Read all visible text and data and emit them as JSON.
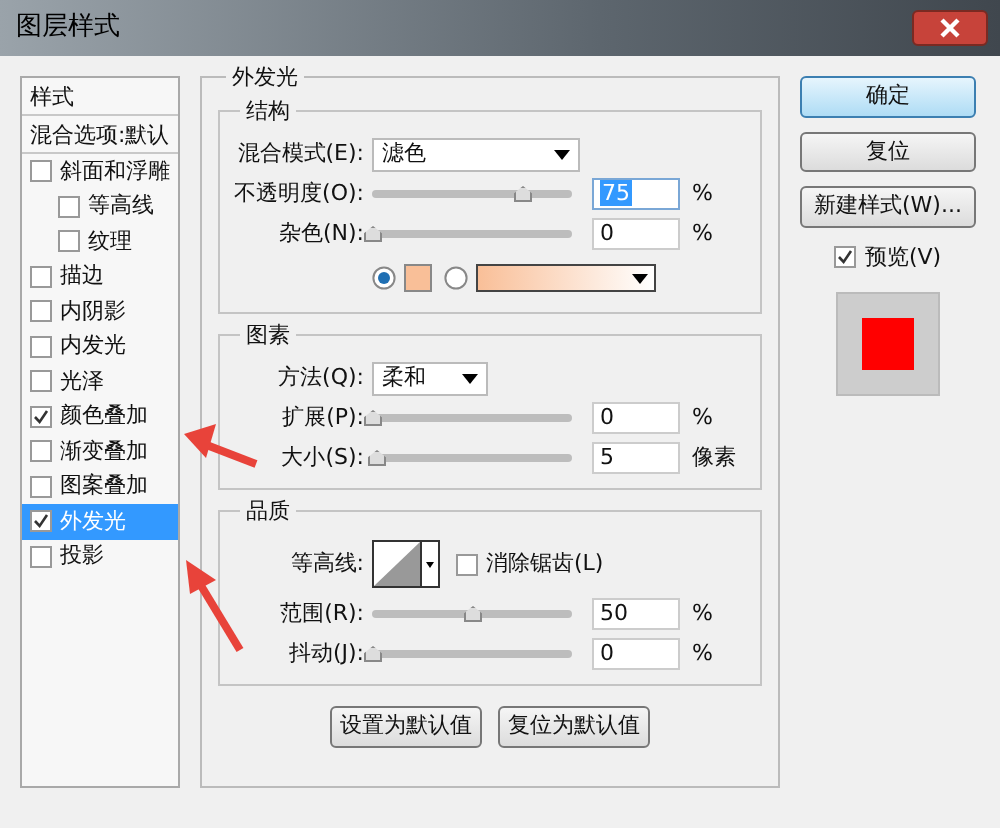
{
  "window": {
    "title": "图层样式"
  },
  "styles_list": {
    "header": "样式",
    "blend_options": "混合选项:默认",
    "items": [
      {
        "label": "斜面和浮雕",
        "checked": false,
        "selected": false,
        "children": [
          {
            "label": "等高线",
            "checked": false,
            "selected": false
          },
          {
            "label": "纹理",
            "checked": false,
            "selected": false
          }
        ]
      },
      {
        "label": "描边",
        "checked": false,
        "selected": false
      },
      {
        "label": "内阴影",
        "checked": false,
        "selected": false
      },
      {
        "label": "内发光",
        "checked": false,
        "selected": false
      },
      {
        "label": "光泽",
        "checked": false,
        "selected": false
      },
      {
        "label": "颜色叠加",
        "checked": true,
        "selected": false
      },
      {
        "label": "渐变叠加",
        "checked": false,
        "selected": false
      },
      {
        "label": "图案叠加",
        "checked": false,
        "selected": false
      },
      {
        "label": "外发光",
        "checked": true,
        "selected": true
      },
      {
        "label": "投影",
        "checked": false,
        "selected": false
      }
    ]
  },
  "outer_glow": {
    "title": "外发光",
    "groups": [
      {
        "title": "结构",
        "rows": [
          {
            "kind": "select",
            "label": "混合模式(E):",
            "value": "滤色",
            "wide": true
          },
          {
            "kind": "slider",
            "label": "不透明度(O):",
            "level": 0.75,
            "value": "75",
            "unit": "%",
            "focused": true
          },
          {
            "kind": "slider",
            "label": "杂色(N):",
            "level": 0,
            "value": "0",
            "unit": "%",
            "focused": false
          },
          {
            "kind": "fill",
            "options": [
              {
                "kind": "solid",
                "selected": true,
                "color": "#f9bf98"
              },
              {
                "kind": "gradient",
                "selected": false,
                "color": "#f9bf98"
              }
            ]
          }
        ]
      },
      {
        "title": "图素",
        "rows": [
          {
            "kind": "select",
            "label": "方法(Q):",
            "value": "柔和",
            "wide": false
          },
          {
            "kind": "slider",
            "label": "扩展(P):",
            "level": 0,
            "value": "0",
            "unit": "%",
            "focused": false
          },
          {
            "kind": "slider",
            "label": "大小(S):",
            "level": 0.02,
            "value": "5",
            "unit": "像素",
            "focused": false
          }
        ]
      },
      {
        "title": "品质",
        "rows": [
          {
            "kind": "contour",
            "label": "等高线:",
            "checkbox": {
              "label": "消除锯齿(L)",
              "checked": false
            }
          },
          {
            "kind": "slider",
            "label": "范围(R):",
            "level": 0.5,
            "value": "50",
            "unit": "%",
            "focused": false
          },
          {
            "kind": "slider",
            "label": "抖动(J):",
            "level": 0,
            "value": "0",
            "unit": "%",
            "focused": false
          }
        ]
      }
    ],
    "buttons": [
      "设置为默认值",
      "复位为默认值"
    ]
  },
  "side": {
    "buttons": [
      {
        "label": "确定",
        "default": true
      },
      {
        "label": "复位",
        "default": false
      },
      {
        "label": "新建样式(W)...",
        "default": false
      }
    ],
    "preview": {
      "label": "预览(V)",
      "checked": true,
      "color": "#ff0000"
    }
  }
}
